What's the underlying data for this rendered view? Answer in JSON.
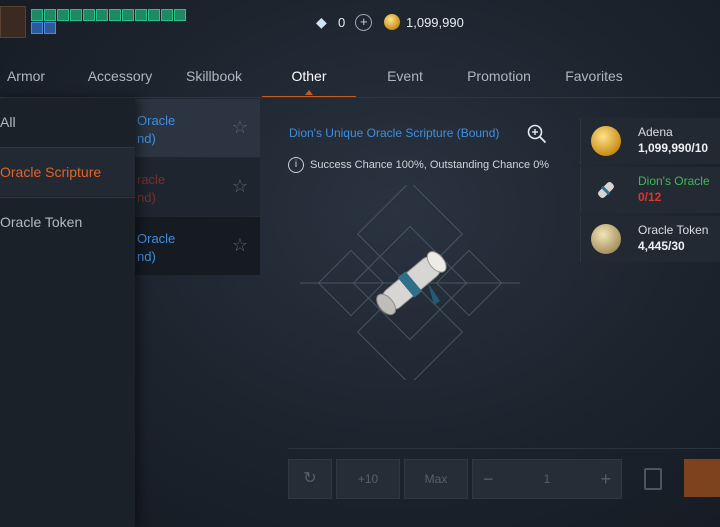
{
  "status_bar": {
    "buff_icons": [
      "g",
      "g",
      "g",
      "g",
      "g",
      "g",
      "g",
      "g",
      "g",
      "g",
      "g",
      "g",
      "b",
      "b"
    ],
    "diamonds": "0",
    "adena": "1,099,990"
  },
  "tabs": [
    {
      "label": "Armor",
      "active": false
    },
    {
      "label": "Accessory",
      "active": false
    },
    {
      "label": "Skillbook",
      "active": false
    },
    {
      "label": "Other",
      "active": true
    },
    {
      "label": "Event",
      "active": false
    },
    {
      "label": "Promotion",
      "active": false
    },
    {
      "label": "Favorites",
      "active": false
    }
  ],
  "dropdown": {
    "items": [
      {
        "label": "All",
        "active": false
      },
      {
        "label": "Oracle Scripture",
        "active": true
      },
      {
        "label": "Oracle Token",
        "active": false
      }
    ]
  },
  "list": [
    {
      "line1": "Oracle",
      "line2": "nd)",
      "color": "#3f8fde"
    },
    {
      "line1": "racle",
      "line2": "nd)",
      "color": "#7a2e2a"
    },
    {
      "line1": "Oracle",
      "line2": "nd)",
      "color": "#3f8fde"
    }
  ],
  "detail": {
    "title": "Dion's Unique Oracle Scripture (Bound)",
    "chance_text": "Success Chance 100%, Outstanding Chance 0%"
  },
  "materials": [
    {
      "name": "Adena",
      "qty": "1,099,990/10",
      "name_color": "#d8dde3",
      "qty_color": "#eef1f4",
      "icon": "coin-icon"
    },
    {
      "name": "Dion's Oracle",
      "qty": "0/12",
      "name_color": "#3dbb55",
      "qty_color": "#e0332a",
      "icon": "scroll-icon"
    },
    {
      "name": "Oracle Token",
      "qty": "4,445/30",
      "name_color": "#d8dde3",
      "qty_color": "#eef1f4",
      "icon": "token-icon"
    }
  ],
  "controls": {
    "plus10": "+10",
    "max": "Max",
    "quantity": "1",
    "minus": "−",
    "plus": "+"
  },
  "colors": {
    "accent": "#c25a22",
    "link": "#3f8fde"
  }
}
